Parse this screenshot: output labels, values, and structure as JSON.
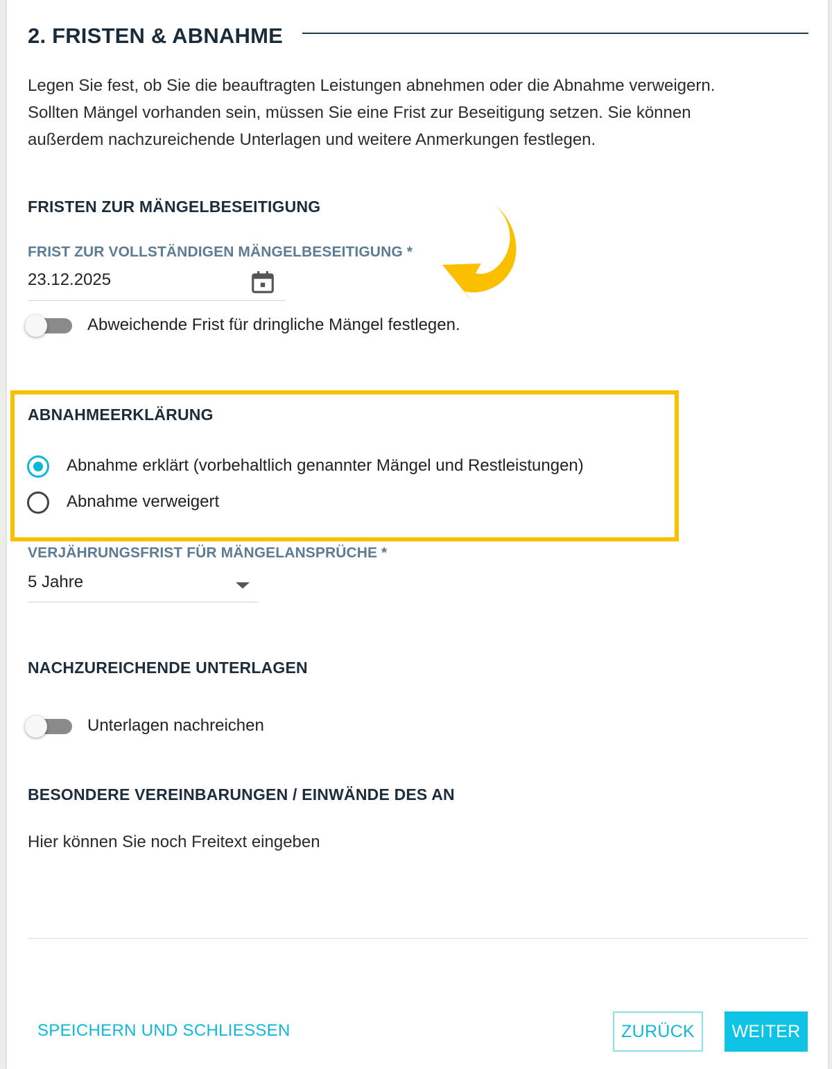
{
  "header": {
    "title": "2. FRISTEN & ABNAHME"
  },
  "intro": {
    "line1": "Legen Sie fest, ob Sie die beauftragten Leistungen abnehmen oder die Abnahme verweigern.",
    "line2": "Sollten Mängel vorhanden sein, müssen Sie eine Frist zur Beseitigung setzen. Sie können",
    "line3": "außerdem nachzureichende Unterlagen und weitere Anmerkungen festlegen."
  },
  "deadlines": {
    "heading": "FRISTEN ZUR MÄNGELBESEITIGUNG",
    "date_label": "FRIST ZUR VOLLSTÄNDIGEN MÄNGELBESEITIGUNG *",
    "date_value": "23.12.2025",
    "toggle_label": "Abweichende Frist für dringliche Mängel festlegen."
  },
  "acceptance": {
    "heading": "ABNAHMEERKLÄRUNG",
    "options": [
      {
        "label": "Abnahme erklärt (vorbehaltlich genannter Mängel und Restleistungen)",
        "selected": true
      },
      {
        "label": "Abnahme verweigert",
        "selected": false
      }
    ]
  },
  "limitation": {
    "label": "VERJÄHRUNGSFRIST FÜR MÄNGELANSPRÜCHE *",
    "value": "5 Jahre"
  },
  "documents": {
    "heading": "NACHZUREICHENDE UNTERLAGEN",
    "toggle_label": "Unterlagen nachreichen"
  },
  "agreements": {
    "heading": "BESONDERE VEREINBARUNGEN / EINWÄNDE DES AN",
    "placeholder": "Hier können Sie noch Freitext eingeben"
  },
  "footer": {
    "save_close": "SPEICHERN UND SCHLIESSEN",
    "back": "ZURÜCK",
    "next": "WEITER"
  },
  "colors": {
    "accent": "#0fc3e5",
    "highlight": "#fbbf00",
    "label": "#5d7c93",
    "heading": "#1d2d3b"
  }
}
